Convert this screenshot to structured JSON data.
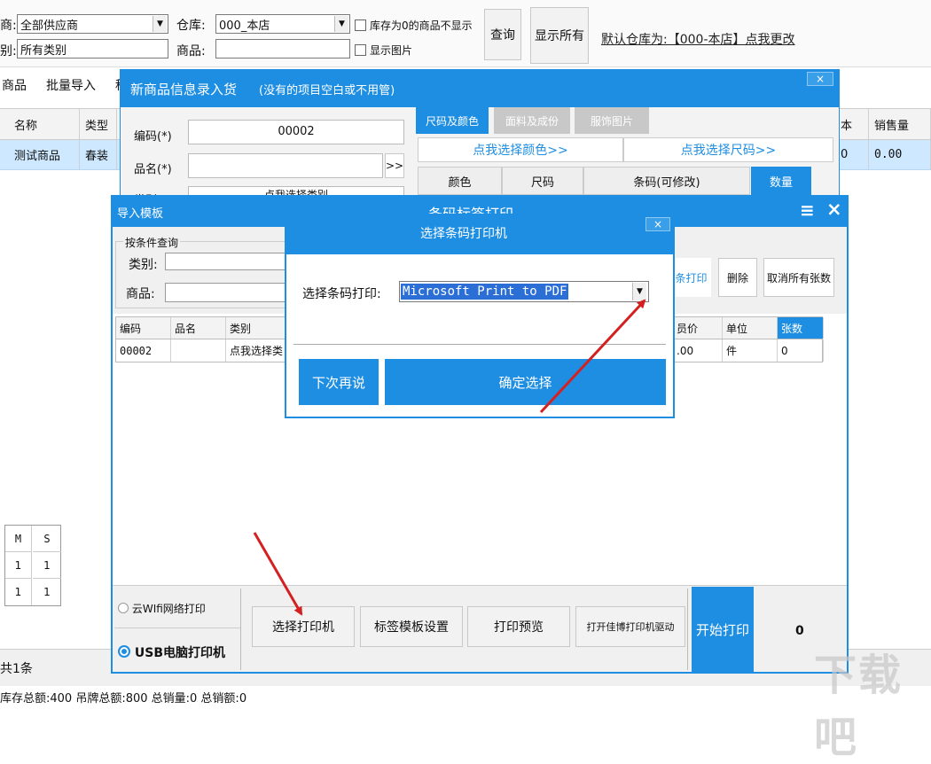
{
  "filter": {
    "supplier_label": "商:",
    "supplier_value": "全部供应商",
    "warehouse_label": "仓库:",
    "warehouse_value": "000_本店",
    "hide_zero_label": "库存为0的商品不显示",
    "category_label": "别:",
    "category_value": "所有类别",
    "product_label": "商品:",
    "show_image_label": "显示图片",
    "query_label": "查询",
    "show_all_label": "显示所有",
    "default_warehouse": "默认仓库为:【000-本店】点我更改"
  },
  "toolbar": {
    "item1": "商品",
    "item2": "批量导入",
    "item3": "秒"
  },
  "main_table": {
    "headers": [
      "名称",
      "类型"
    ],
    "row": [
      "测试商品",
      "春装"
    ],
    "right_headers": [
      "本",
      "销售量"
    ],
    "right_row": [
      "0",
      "0.00"
    ]
  },
  "size_grid": {
    "headers": [
      "M",
      "S"
    ],
    "rows": [
      [
        "1",
        "1"
      ],
      [
        "1",
        "1"
      ]
    ]
  },
  "status": {
    "count": "共1条",
    "summary": "库存总额:400 吊牌总额:800 总销量:0 总销额:0"
  },
  "new_product": {
    "title": "新商品信息录入货",
    "subtitle": "(没有的项目空白或不用管)",
    "close": "×",
    "code_label": "编码(*)",
    "code_value": "00002",
    "name_label": "品名(*)",
    "name_btn": ">>",
    "category_label": "类别(*)",
    "category_value": "点我选择类别",
    "tabs": [
      "尺码及颜色",
      "面料及成份",
      "服饰图片"
    ],
    "pick_color": "点我选择颜色>>",
    "pick_size": "点我选择尺码>>",
    "grid_headers": [
      "颜色",
      "尺码",
      "条码(可修改)",
      "数量"
    ]
  },
  "barcode": {
    "left_title": "导入模板",
    "title": "条码标签打印",
    "menu_icon": "≡",
    "close": "×",
    "cond_label": "按条件查询",
    "category_label": "类别:",
    "product_label": "商品:",
    "btn_print": "条打印",
    "btn_delete": "删除",
    "btn_cancel_all": "取消所有张数",
    "table_headers": [
      "编码",
      "品名",
      "类别",
      "员价",
      "单位",
      "张数"
    ],
    "table_row": [
      "00002",
      "",
      "点我选择类",
      ".00",
      "件",
      "0"
    ],
    "radio_cloud": "云WIfi网络打印",
    "radio_usb": "USB电脑打印机",
    "btn_select_printer": "选择打印机",
    "btn_label_template": "标签模板设置",
    "btn_preview": "打印预览",
    "btn_driver": "打开佳博打印机驱动",
    "btn_start": "开始打印",
    "count": "0"
  },
  "dialog": {
    "title": "选择条码打印机",
    "close": "×",
    "label": "选择条码打印:",
    "printer": "Microsoft Print to PDF",
    "btn_later": "下次再说",
    "btn_confirm": "确定选择"
  },
  "watermark": "下载吧",
  "colors": {
    "accent": "#1e8ee3",
    "highlight_row": "#cde8ff",
    "arrow": "#d42020"
  }
}
